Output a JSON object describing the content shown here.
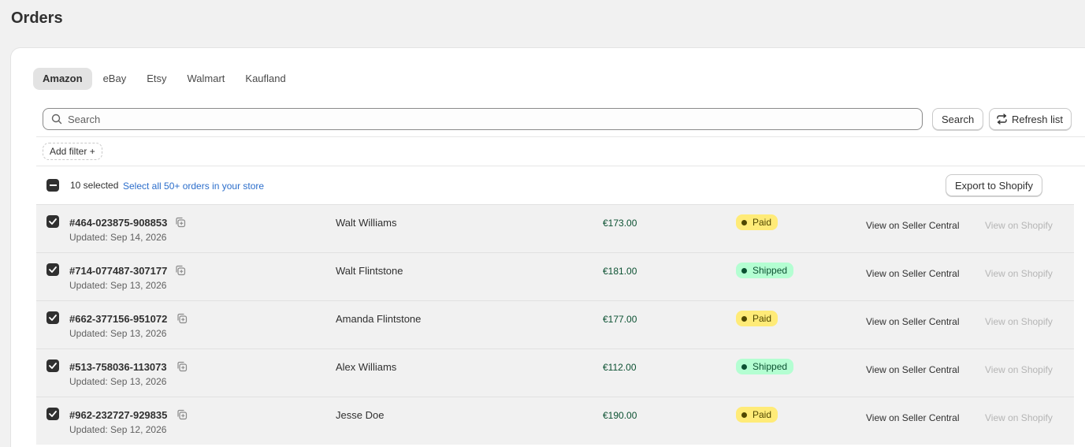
{
  "page": {
    "title": "Orders"
  },
  "tabs": [
    {
      "label": "Amazon",
      "active": true
    },
    {
      "label": "eBay",
      "active": false
    },
    {
      "label": "Etsy",
      "active": false
    },
    {
      "label": "Walmart",
      "active": false
    },
    {
      "label": "Kaufland",
      "active": false
    }
  ],
  "search": {
    "placeholder": "Search",
    "value": "",
    "button_label": "Search"
  },
  "toolbar": {
    "refresh_label": "Refresh list",
    "add_filter_label": "Add filter +"
  },
  "selection": {
    "count_text": "10 selected",
    "select_all_text": "Select all 50+ orders in your store",
    "export_label": "Export to Shopify"
  },
  "orders": [
    {
      "id": "#464-023875-908853",
      "updated": "Updated: Sep 14, 2026",
      "customer": "Walt Williams",
      "amount": "€173.00",
      "status": "Paid",
      "status_type": "paid",
      "seller_link": "View on Seller Central",
      "shopify_link": "View on Shopify"
    },
    {
      "id": "#714-077487-307177",
      "updated": "Updated: Sep 13, 2026",
      "customer": "Walt Flintstone",
      "amount": "€181.00",
      "status": "Shipped",
      "status_type": "shipped",
      "seller_link": "View on Seller Central",
      "shopify_link": "View on Shopify"
    },
    {
      "id": "#662-377156-951072",
      "updated": "Updated: Sep 13, 2026",
      "customer": "Amanda Flintstone",
      "amount": "€177.00",
      "status": "Paid",
      "status_type": "paid",
      "seller_link": "View on Seller Central",
      "shopify_link": "View on Shopify"
    },
    {
      "id": "#513-758036-113073",
      "updated": "Updated: Sep 13, 2026",
      "customer": "Alex Williams",
      "amount": "€112.00",
      "status": "Shipped",
      "status_type": "shipped",
      "seller_link": "View on Seller Central",
      "shopify_link": "View on Shopify"
    },
    {
      "id": "#962-232727-929835",
      "updated": "Updated: Sep 12, 2026",
      "customer": "Jesse Doe",
      "amount": "€190.00",
      "status": "Paid",
      "status_type": "paid",
      "seller_link": "View on Seller Central",
      "shopify_link": "View on Shopify"
    }
  ],
  "colors": {
    "paid_bg": "#ffeb78",
    "shipped_bg": "#b4fed2",
    "link": "#2c6ecb",
    "amount": "#0c5132"
  }
}
